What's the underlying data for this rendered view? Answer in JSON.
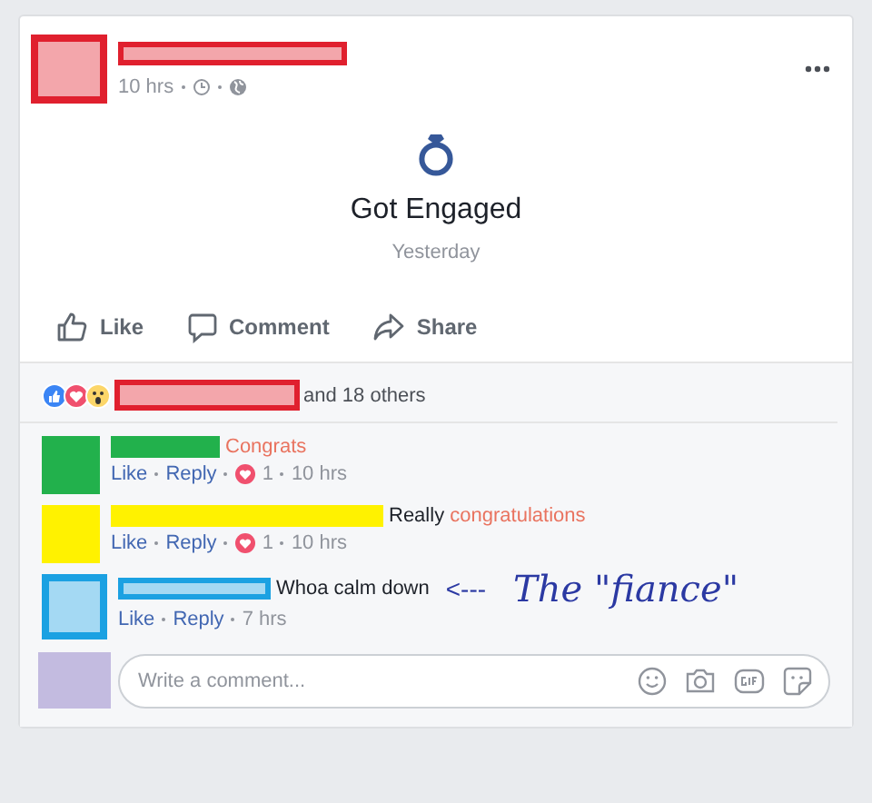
{
  "post": {
    "author": {
      "color": "#e0202e",
      "kind": "outlined"
    },
    "time": "10 hrs",
    "event": {
      "title": "Got Engaged",
      "date": "Yesterday"
    },
    "actions": [
      "Like",
      "Comment",
      "Share"
    ],
    "reactions": {
      "names": {
        "color": "#e0202e",
        "kind": "outlined"
      },
      "others": "and 18 others"
    },
    "comments": [
      {
        "color": "#22b14c",
        "kind": "solid",
        "parts": [
          {
            "text": "Congrats",
            "highlight": true
          }
        ],
        "like": "Like",
        "reply": "Reply",
        "reaction_count": "1",
        "time": "10 hrs"
      },
      {
        "color": "#fff200",
        "kind": "solid",
        "parts": [
          {
            "text": "Really",
            "highlight": false
          },
          {
            "text": "congratulations",
            "highlight": true
          }
        ],
        "like": "Like",
        "reply": "Reply",
        "reaction_count": "1",
        "time": "10 hrs"
      },
      {
        "color": "#1ba1e2",
        "kind": "outlined",
        "parts": [
          {
            "text": "Whoa calm down",
            "highlight": false
          }
        ],
        "like": "Like",
        "reply": "Reply",
        "time": "7 hrs",
        "annotation": {
          "arrow": "<---",
          "text": "The \"fiance\""
        }
      }
    ],
    "composer": {
      "placeholder": "Write a comment..."
    }
  }
}
